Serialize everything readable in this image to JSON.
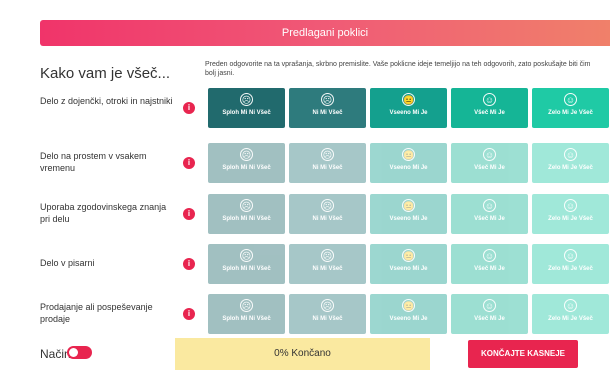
{
  "header": {
    "banner_title": "Predlagani poklici",
    "page_title": "Kako vam je všeč...",
    "instructions": "Preden odgovorite na ta vprašanja, skrbno premislite. Vaše poklicne ideje temeljijo na teh odgovorih, zato poskušajte biti čim bolj jasni."
  },
  "options": [
    {
      "label": "Sploh Mi Ni Všeč",
      "icon": "very-sad-face-icon",
      "glyph": "☹"
    },
    {
      "label": "Ni Mi Všeč",
      "icon": "sad-face-icon",
      "glyph": "☹"
    },
    {
      "label": "Vseeno Mi Je",
      "icon": "neutral-face-icon",
      "glyph": "😐"
    },
    {
      "label": "Všeč Mi Je",
      "icon": "happy-face-icon",
      "glyph": "☺"
    },
    {
      "label": "Zelo Mi Je Všeč",
      "icon": "very-happy-face-icon",
      "glyph": "☺"
    }
  ],
  "questions": [
    {
      "label": "Delo z dojenčki, otroki in najstniki",
      "info": "i",
      "active": true
    },
    {
      "label": "Delo na prostem v vsakem vremenu",
      "info": "i",
      "active": false
    },
    {
      "label": "Uporaba zgodovinskega znanja pri delu",
      "info": "i",
      "active": false
    },
    {
      "label": "Delo v pisarni",
      "info": "i",
      "active": false
    },
    {
      "label": "Prodajanje ali pospeševanje prodaje",
      "info": "i",
      "active": false
    }
  ],
  "footer": {
    "mode_label": "Način",
    "mode_toggle_on": true,
    "progress_text": "0% Končano",
    "progress_value": 0,
    "later_button": "KONČAJTE KASNEJE"
  },
  "colors": {
    "accent": "#e8254f",
    "option_colors": [
      "#216a6d",
      "#2e7b7d",
      "#14a08e",
      "#15b596",
      "#1fcaa5"
    ],
    "progress_bg": "#fae9a0"
  }
}
